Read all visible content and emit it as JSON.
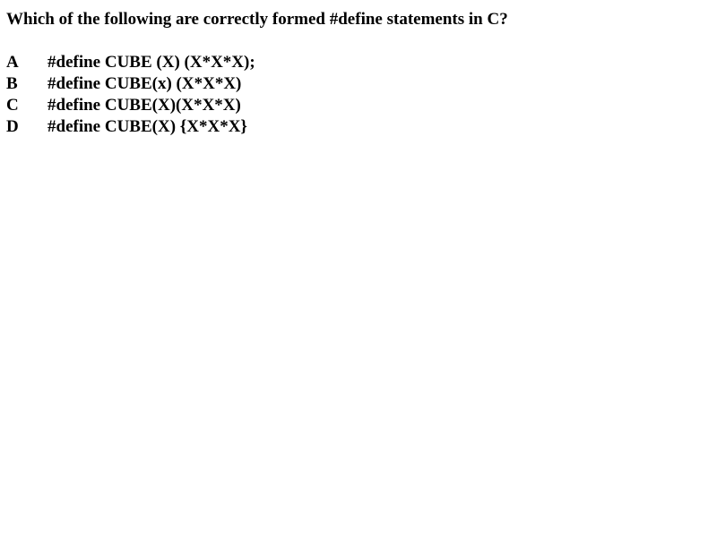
{
  "question": {
    "text": "Which of the following are correctly formed #define statements in C?"
  },
  "options": [
    {
      "letter": "A",
      "text": "#define CUBE (X) (X*X*X);"
    },
    {
      "letter": "B",
      "text": "#define CUBE(x) (X*X*X)"
    },
    {
      "letter": "C",
      "text": "#define CUBE(X)(X*X*X)"
    },
    {
      "letter": "D",
      "text": "#define CUBE(X) {X*X*X}"
    }
  ]
}
